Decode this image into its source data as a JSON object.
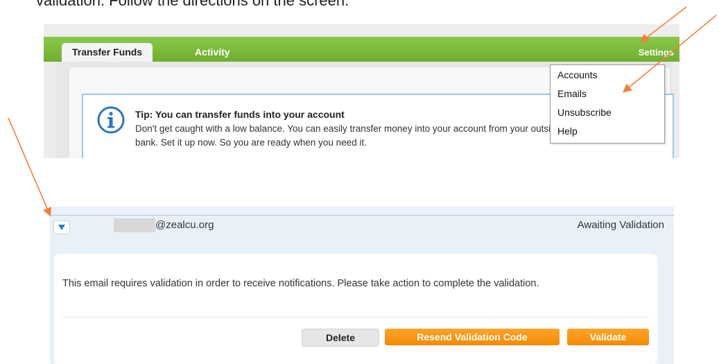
{
  "caption": "validation. Follow the directions on the screen.",
  "header": {
    "tabs": [
      {
        "label": "Transfer Funds",
        "active": true
      },
      {
        "label": "Activity",
        "active": false
      }
    ],
    "settings_label": "Settings"
  },
  "tip": {
    "title": "Tip: You can transfer funds into your account",
    "body": "Don't get caught with a low balance. You can easily transfer money into your account from your outside bank. Set it up now. So you are ready when you need it.",
    "icon": "info-icon"
  },
  "settings_menu": {
    "items": [
      "Accounts",
      "Emails",
      "Unsubscribe",
      "Help"
    ]
  },
  "email_row": {
    "email_suffix": "@zealcu.org",
    "status": "Awaiting Validation",
    "message": "This email requires validation in order to receive notifications. Please take action to complete the validation.",
    "buttons": {
      "delete": "Delete",
      "resend": "Resend Validation Code",
      "validate": "Validate"
    }
  },
  "colors": {
    "header_green": "#7dbb3e",
    "action_orange": "#f7941d",
    "annotation_arrow": "#f07f3c",
    "info_blue": "#2b76c2"
  }
}
